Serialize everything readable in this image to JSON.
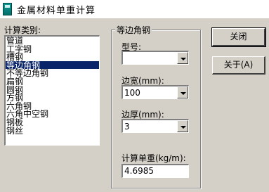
{
  "window": {
    "title": "金属材料单重计算",
    "icon": "calculator-icon"
  },
  "category_label": "计算类别:",
  "categories": [
    "管道",
    "工字钢",
    "槽钢",
    "等边角钢",
    "不等边角钢",
    "扁钢",
    "圆钢",
    "方钢",
    "六角钢",
    "六角中空钢",
    "钢板",
    "钢丝"
  ],
  "selected_category": "等边角钢",
  "group": {
    "title": "等边角钢",
    "model": {
      "label": "型号:",
      "value": ""
    },
    "width": {
      "label": "边宽(mm):",
      "value": "100"
    },
    "thickness": {
      "label": "边厚(mm):",
      "value": "3"
    },
    "result": {
      "label": "计算单重(kg/m):",
      "value": "4.6985"
    }
  },
  "buttons": {
    "close": "关闭",
    "about": "关于(A)"
  }
}
